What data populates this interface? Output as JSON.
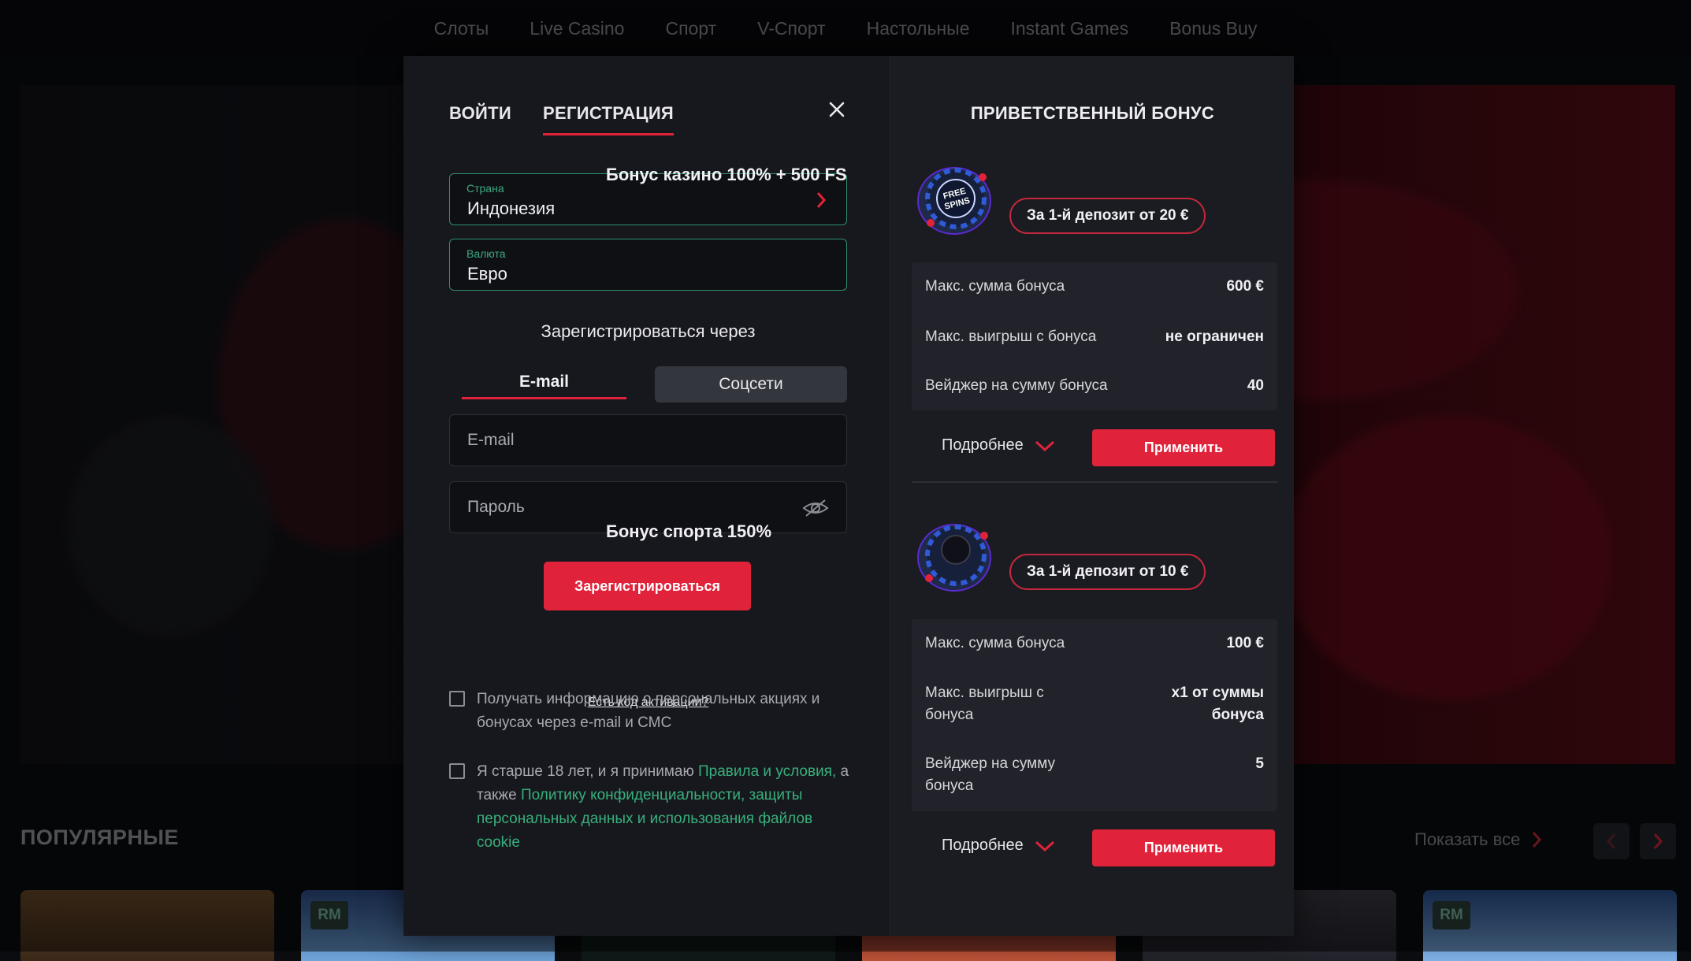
{
  "topnav": {
    "items": [
      "Слоты",
      "Live Casino",
      "Спорт",
      "V-Спорт",
      "Настольные",
      "Instant Games",
      "Bonus Buy"
    ]
  },
  "popular": {
    "title": "ПОПУЛЯРНЫЕ",
    "show_all": "Показать все",
    "badge": "RM"
  },
  "modal": {
    "tabs": {
      "login": "ВОЙТИ",
      "register": "РЕГИСТРАЦИЯ"
    },
    "country": {
      "label": "Страна",
      "value": "Индонезия"
    },
    "currency": {
      "label": "Валюта",
      "value": "Евро"
    },
    "register_via": "Зарегистрироваться через",
    "subtabs": {
      "email": "E-mail",
      "social": "Соцсети"
    },
    "email_placeholder": "E-mail",
    "password_placeholder": "Пароль",
    "register_button": "Зарегистрироваться",
    "activation_link": "Есть код активации?",
    "consent_promo": "Получать информацию о персональных акциях и бонусах через e-mail и СМС",
    "consent_age": {
      "prefix": "Я старше 18 лет, и я принимаю ",
      "link1": "Правила и условия,",
      "middle": " а также ",
      "link2": "Политику конфиденциальности, защиты персональных данных и использования файлов cookie"
    }
  },
  "bonus": {
    "header": "ПРИВЕТСТВЕННЫЙ БОНУС",
    "more_label": "Подробнее",
    "apply_label": "Применить",
    "casino": {
      "title": "Бонус казино 100% + 500 FS",
      "deposit": "За 1-й депозит от 20 €",
      "icon_text": "FREE SPINS",
      "rows": [
        {
          "label": "Макс. сумма бонуса",
          "value": "600 €"
        },
        {
          "label": "Макс. выигрыш с бонуса",
          "value": "не ограничен"
        },
        {
          "label": "Вейджер на сумму бонуса",
          "value": "40"
        }
      ]
    },
    "sport": {
      "title": "Бонус спорта 150%",
      "deposit": "За 1-й депозит от 10 €",
      "rows": [
        {
          "label": "Макс. сумма бонуса",
          "value": "100 €"
        },
        {
          "label": "Макс. выигрыш с бонуса",
          "value": "x1 от суммы бонуса"
        },
        {
          "label": "Вейджер на сумму бонуса",
          "value": "5"
        }
      ]
    }
  },
  "colors": {
    "accent": "#e0223a",
    "field_border": "#2f8f6e",
    "link_green": "#37b07c",
    "background": "#0b0c0f"
  }
}
